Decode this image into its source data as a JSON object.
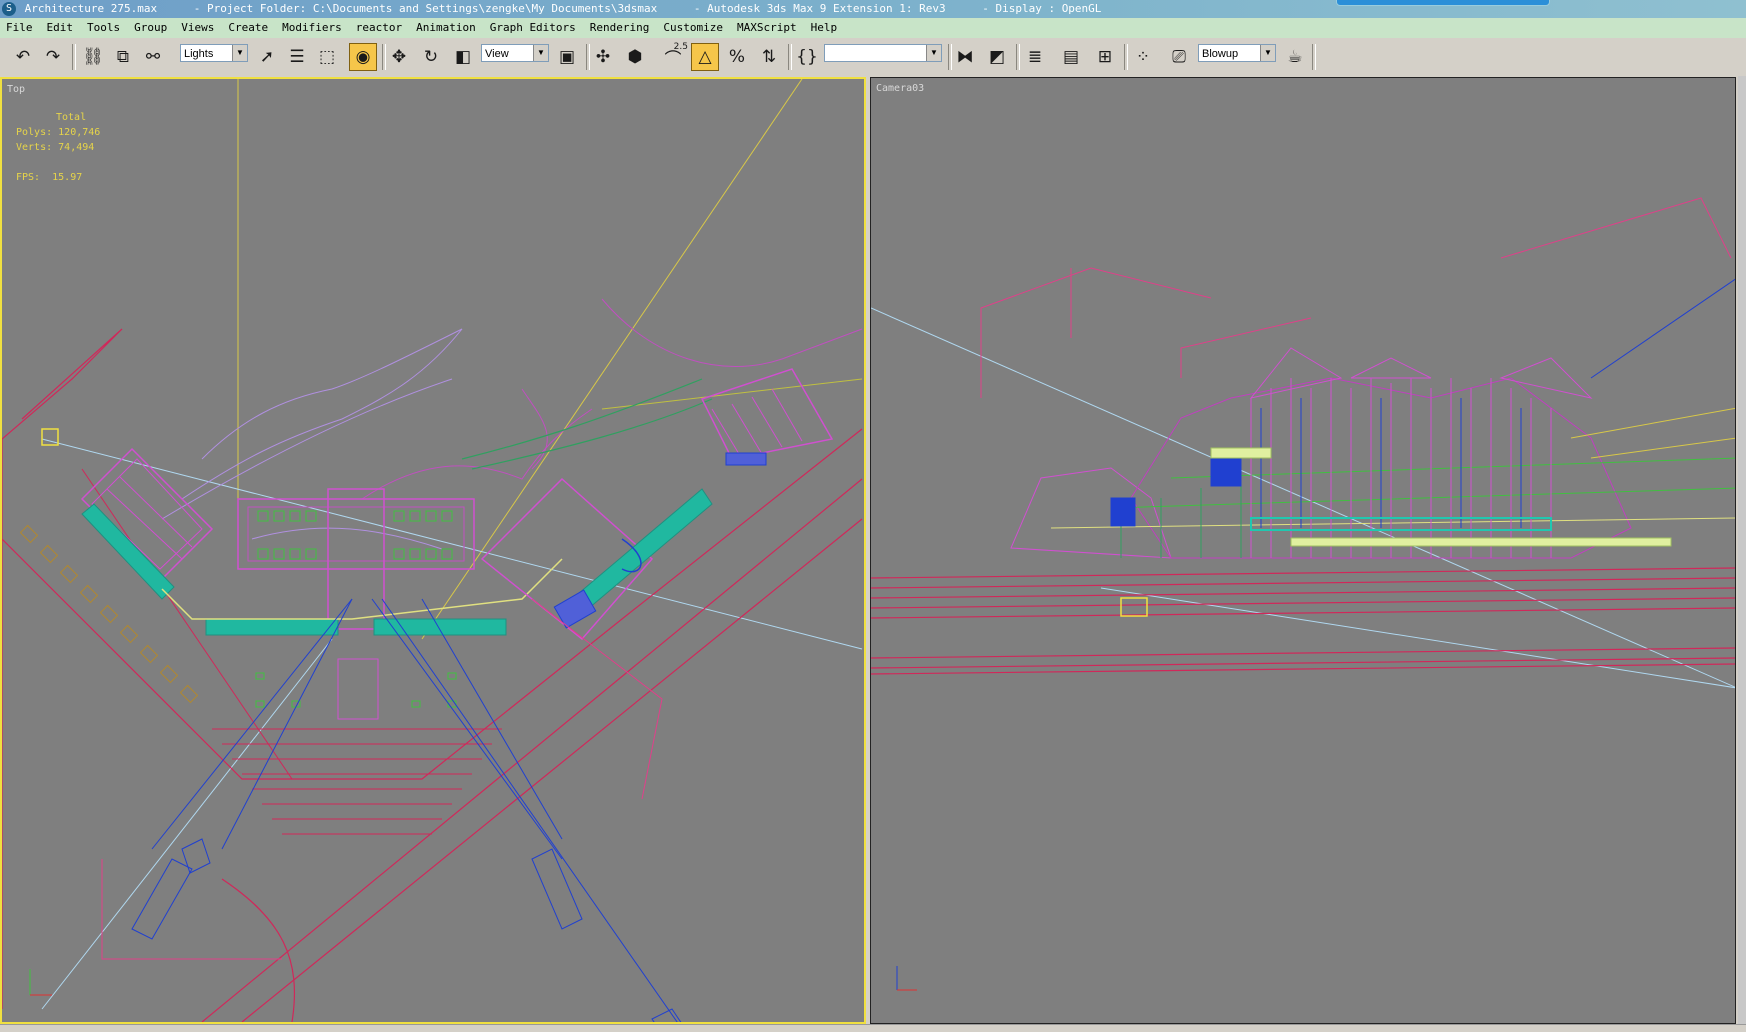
{
  "window": {
    "title_segments": [
      "Architecture 275.max",
      "- Project Folder: C:\\Documents and Settings\\zengke\\My Documents\\3dsmax",
      "- Autodesk 3ds Max 9 Extension 1: Rev3",
      "- Display : OpenGL"
    ]
  },
  "menu": [
    "File",
    "Edit",
    "Tools",
    "Group",
    "Views",
    "Create",
    "Modifiers",
    "reactor",
    "Animation",
    "Graph Editors",
    "Rendering",
    "Customize",
    "MAXScript",
    "Help"
  ],
  "toolbar": {
    "selection_filter": "Lights",
    "reference_coord": "View",
    "named_selection": "",
    "render_preset": "Blowup",
    "snap_label": "2.5",
    "icons": [
      "undo-icon",
      "redo-icon",
      "select-link-icon",
      "unlink-icon",
      "bind-spacewarp-icon",
      "select-object-icon",
      "select-by-name-icon",
      "rect-region-icon",
      "window-crossing-icon",
      "move-icon",
      "rotate-icon",
      "scale-icon",
      "pivot-icon",
      "manipulate-icon",
      "snap-toggle-icon",
      "angle-snap-icon",
      "percent-snap-icon",
      "spinner-snap-icon",
      "edit-named-sel-icon",
      "mirror-icon",
      "align-icon",
      "layer-manager-icon",
      "curve-editor-icon",
      "schematic-icon",
      "material-editor-icon",
      "render-scene-icon",
      "quick-render-icon"
    ]
  },
  "viewports": {
    "top": {
      "label": "Top",
      "stats_header": "Total",
      "polys_label": "Polys:",
      "polys": "120,746",
      "verts_label": "Verts:",
      "verts": "74,494",
      "fps_label": "FPS:",
      "fps": "15.97"
    },
    "camera": {
      "label": "Camera03"
    }
  },
  "colors": {
    "viewport_bg": "#7f7f7f",
    "active_border": "#f0e040",
    "stats_text": "#e6d44a",
    "menubar_bg": "#c8e4c8",
    "wire_magenta": "#d050d0",
    "wire_pink": "#e0408a",
    "wire_teal": "#20b8a0",
    "wire_blue": "#2040d0",
    "wire_green": "#40c040"
  }
}
